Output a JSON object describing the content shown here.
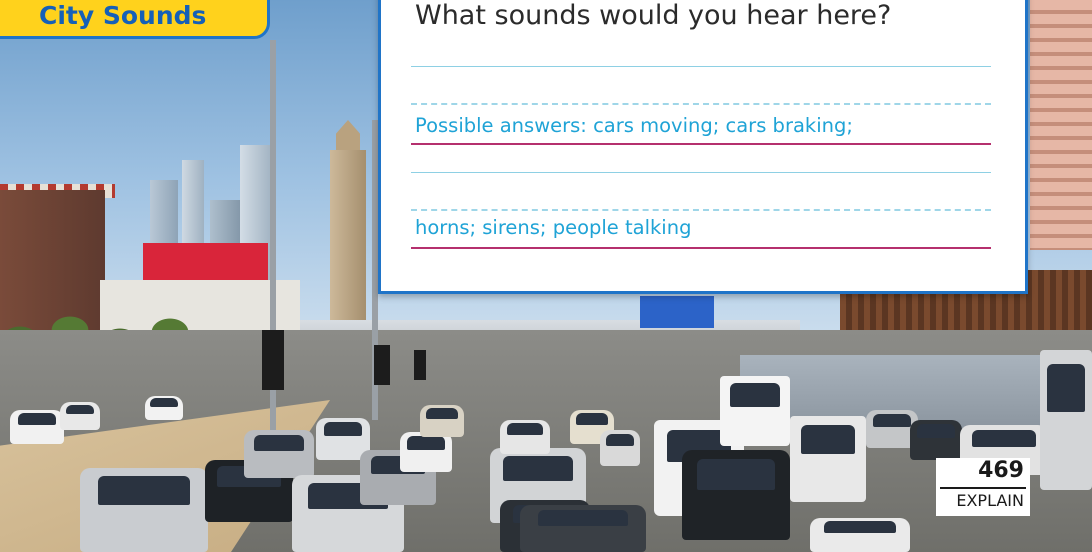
{
  "header": {
    "title": "City Sounds"
  },
  "card": {
    "question": "What sounds would you hear here?",
    "answer_line_1": "Possible answers: cars moving; cars braking;",
    "answer_line_2": "horns; sirens; people talking"
  },
  "page": {
    "number": "469",
    "label": "EXPLAIN"
  },
  "colors": {
    "accent_blue": "#1f74c8",
    "tab_yellow": "#ffd21c",
    "answer_text": "#1fa3d6",
    "baseline_magenta": "#b5306e"
  },
  "background": {
    "image_subject": "city-traffic-photo"
  }
}
